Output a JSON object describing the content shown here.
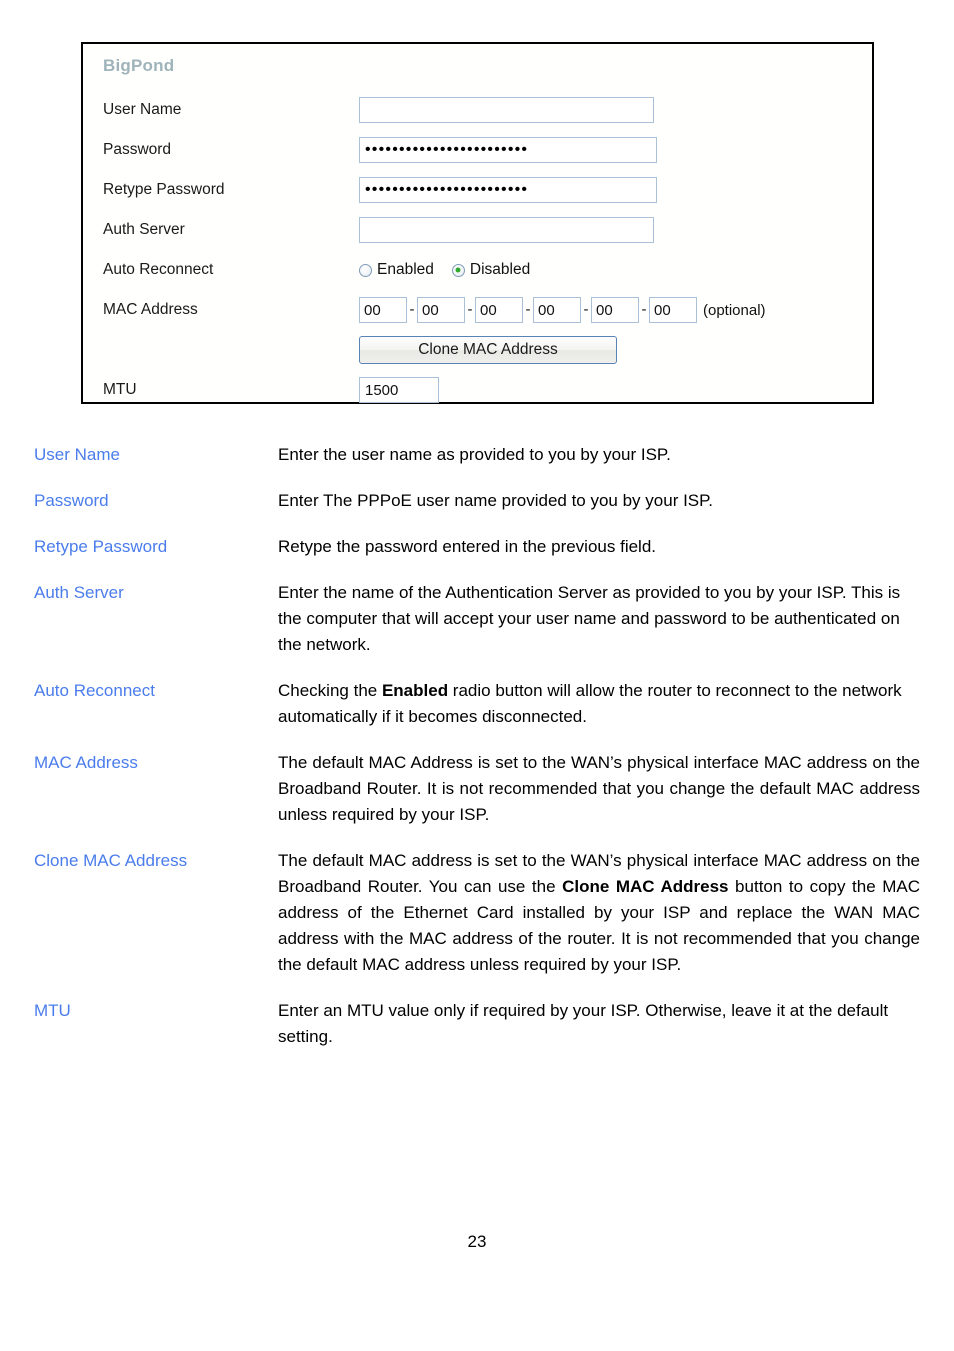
{
  "screenshot": {
    "title": "BigPond",
    "fields": [
      {
        "label": "User Name",
        "type": "text",
        "value": "",
        "placeholder": ""
      },
      {
        "label": "Password",
        "type": "password",
        "value": "••••••••••••••••••••••••"
      },
      {
        "label": "Retype Password",
        "type": "password",
        "value": "••••••••••••••••••••••••"
      },
      {
        "label": "Auth Server",
        "type": "text",
        "value": "",
        "placeholder": ""
      },
      {
        "label": "Auto Reconnect",
        "type": "radio"
      },
      {
        "label": "MAC Address",
        "type": "mac"
      },
      {
        "label": "MTU",
        "type": "text",
        "value": "1500"
      }
    ],
    "labels": {
      "user_name": "User Name",
      "password": "Password",
      "retype_password": "Retype Password",
      "auth_server": "Auth Server",
      "auto_reconnect": "Auto Reconnect",
      "mac_address": "MAC Address",
      "mtu": "MTU"
    },
    "values": {
      "user_name": "",
      "password": "••••••••••••••••••••••••",
      "retype_password": "••••••••••••••••••••••••",
      "auth_server": "",
      "mtu": "1500"
    },
    "auto_reconnect": {
      "enabled_label": "Enabled",
      "disabled_label": "Disabled",
      "selected": "Disabled"
    },
    "mac": {
      "octets": [
        "00",
        "00",
        "00",
        "00",
        "00",
        "00"
      ],
      "separator": "-",
      "optional_note": "(optional)",
      "clone_button": "Clone MAC Address"
    },
    "colors": {
      "title": "#9fb4ba",
      "input_border": "#a9c0d8",
      "panel_border": "#000000",
      "radio_selected_dot": "#2faa2f",
      "button_border": "#5a83b5"
    }
  },
  "definitions": [
    {
      "term": "User Name",
      "desc_pre": "Enter the user name as provided to you by your ISP.",
      "desc_bold": "",
      "desc_post": "",
      "justify": false
    },
    {
      "term": "Password",
      "desc_pre": "Enter The PPPoE user name provided to you by your ISP.",
      "desc_bold": "",
      "desc_post": "",
      "justify": false
    },
    {
      "term": "Retype Password",
      "desc_pre": "Retype the password entered in the previous field.",
      "desc_bold": "",
      "desc_post": "",
      "justify": false
    },
    {
      "term": "Auth Server",
      "desc_pre": "Enter the name of the Authentication Server as provided to you by your ISP. This is the computer that will accept your user name and password to be authenticated on the network.",
      "desc_bold": "",
      "desc_post": "",
      "justify": false
    },
    {
      "term": "Auto Reconnect",
      "desc_pre": "Checking the ",
      "desc_bold": "Enabled",
      "desc_post": " radio button will allow the router to reconnect to the network automatically if it becomes disconnected.",
      "justify": false
    },
    {
      "term": "MAC Address",
      "desc_pre": "The default MAC Address is set to the WAN’s physical interface MAC address on the Broadband Router. It is not recommended that you change the default MAC address unless required by your ISP.",
      "desc_bold": "",
      "desc_post": "",
      "justify": true
    },
    {
      "term": "Clone MAC Address",
      "desc_pre": "The default MAC address is set to the WAN’s physical interface MAC address on the Broadband Router. You can use the ",
      "desc_bold": "Clone MAC Address",
      "desc_post": " button to copy the MAC address of the Ethernet Card installed by your ISP and replace the WAN MAC address with the MAC address of the router. It is not recommended that you change the default MAC address unless required by your ISP.",
      "justify": true
    },
    {
      "term": "MTU",
      "desc_pre": "Enter an MTU value only if required by your ISP. Otherwise, leave it at the default setting.",
      "desc_bold": "",
      "desc_post": "",
      "justify": false
    }
  ],
  "footer": {
    "page_number": "23"
  }
}
